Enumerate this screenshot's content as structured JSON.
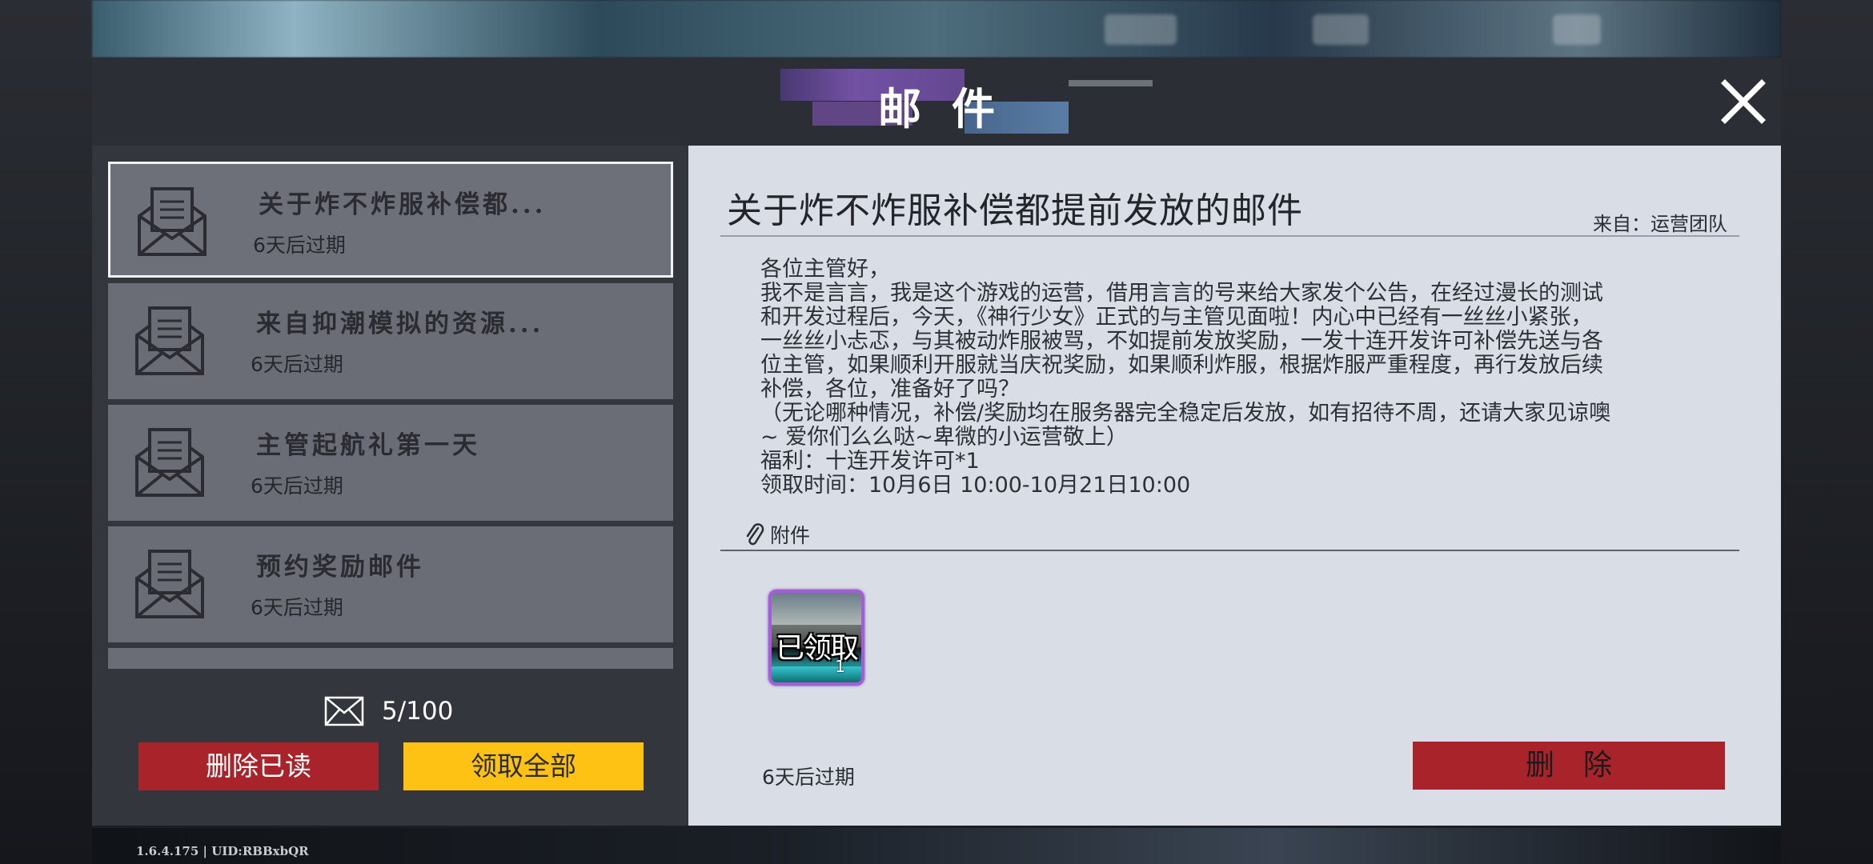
{
  "window": {
    "title": "邮件",
    "version": "1.6.4.175 | UID:RBBxbQR"
  },
  "mail_list": {
    "items": [
      {
        "title": "关于炸不炸服补偿都...",
        "expire": "6天后过期",
        "selected": true
      },
      {
        "title": "来自抑潮模拟的资源...",
        "expire": "6天后过期",
        "selected": false
      },
      {
        "title": "主管起航礼第一天",
        "expire": "6天后过期",
        "selected": false
      },
      {
        "title": "预约奖励邮件",
        "expire": "6天后过期",
        "selected": false
      }
    ],
    "count": "5/100",
    "delete_read_label": "删除已读",
    "claim_all_label": "领取全部"
  },
  "detail": {
    "title": "关于炸不炸服补偿都提前发放的邮件",
    "from": "来自：运营团队",
    "body": "各位主管好，\n我不是言言，我是这个游戏的运营，借用言言的号来给大家发个公告，在经过漫长的测试\n和开发过程后，今天，《神行少女》正式的与主管见面啦！内心中已经有一丝丝小紧张，\n一丝丝小忐忑，与其被动炸服被骂，不如提前发放奖励，一发十连开发许可补偿先送与各\n位主管，如果顺利开服就当庆祝奖励，如果顺利炸服，根据炸服严重程度，再行发放后续\n补偿，各位，准备好了吗？\n（无论哪种情况，补偿/奖励均在服务器完全稳定后发放，如有招待不周，还请大家见谅噢\n~ 爱你们么么哒~卑微的小运营敬上）\n福利：十连开发许可*1\n领取时间：10月6日 10:00-10月21日10:00",
    "attachment_label": "附件",
    "attachment": {
      "status": "已领取",
      "quantity": "1"
    },
    "expire": "6天后过期",
    "delete_label": "删除"
  },
  "colors": {
    "accent_red": "#a8232a",
    "accent_yellow": "#fec214",
    "panel_dark": "#33363d",
    "detail_bg": "#d8dde6"
  }
}
